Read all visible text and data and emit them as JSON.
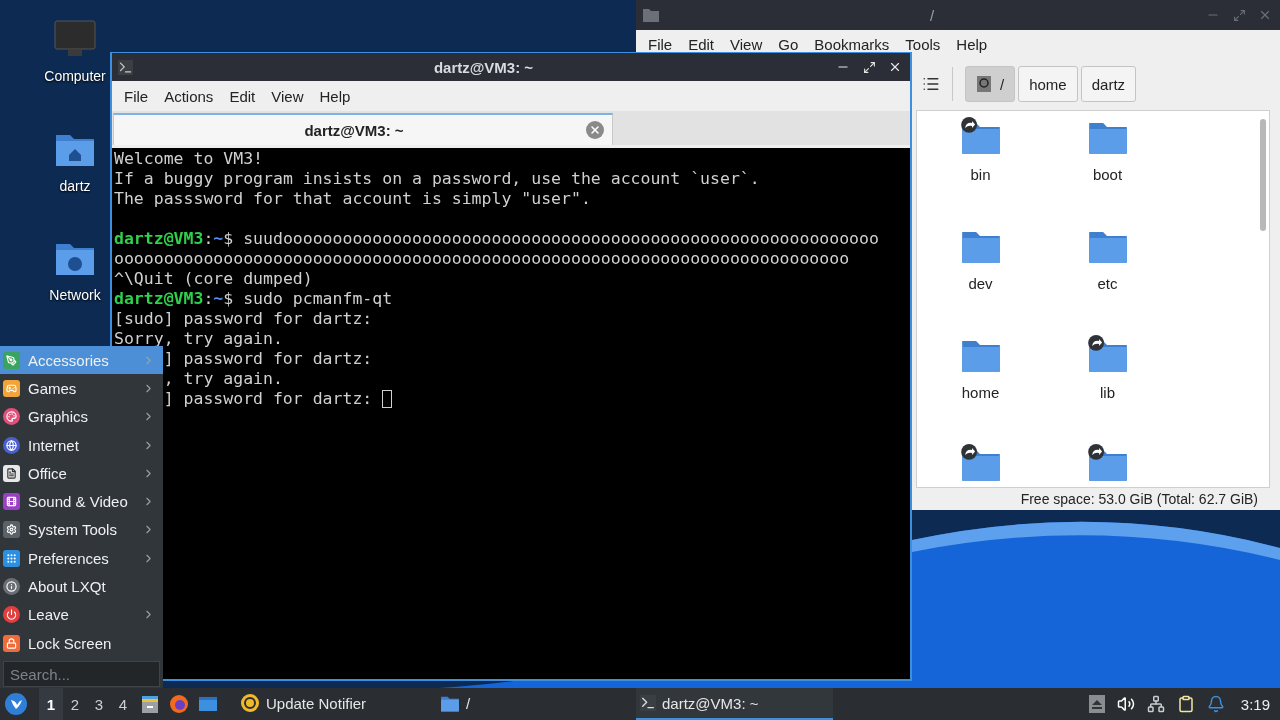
{
  "desktop_icons": [
    {
      "label": "Computer",
      "kind": "computer"
    },
    {
      "label": "dartz",
      "kind": "home"
    },
    {
      "label": "Network",
      "kind": "network"
    }
  ],
  "file_manager": {
    "title": "/",
    "menu": [
      "File",
      "Edit",
      "View",
      "Go",
      "Bookmarks",
      "Tools",
      "Help"
    ],
    "path": [
      {
        "label": "/",
        "selected": true
      },
      {
        "label": "home",
        "selected": false
      },
      {
        "label": "dartz",
        "selected": false
      }
    ],
    "items": [
      {
        "name": "bin",
        "link": true
      },
      {
        "name": "boot",
        "link": false
      },
      {
        "name": "dev",
        "link": false
      },
      {
        "name": "etc",
        "link": false
      },
      {
        "name": "home",
        "link": false
      },
      {
        "name": "lib",
        "link": true
      },
      {
        "link": true
      },
      {
        "link": true
      }
    ],
    "status": "Free space: 53.0 GiB (Total: 62.7 GiB)"
  },
  "terminal": {
    "title": "dartz@VM3: ~",
    "menu": [
      "File",
      "Actions",
      "Edit",
      "View",
      "Help"
    ],
    "tabs": [
      {
        "label": "dartz@VM3: ~",
        "selected": true
      }
    ],
    "lines": [
      {
        "kind": "text",
        "text": "Welcome to VM3!"
      },
      {
        "kind": "text",
        "text": "If a buggy program insists on a password, use the account `user`."
      },
      {
        "kind": "text",
        "text": "The passsword for that account is simply \"user\"."
      },
      {
        "kind": "blank"
      },
      {
        "kind": "prompt",
        "user": "dartz@VM3",
        "sep": ":",
        "path": "~",
        "symbol": "$",
        "command": "suudoooooooooooooooooooooooooooooooooooooooooooooooooooooooooooo"
      },
      {
        "kind": "text",
        "text": "oooooooooooooooooooooooooooooooooooooooooooooooooooooooooooooooooooooooooo"
      },
      {
        "kind": "text",
        "text": "^\\Quit (core dumped)"
      },
      {
        "kind": "prompt",
        "user": "dartz@VM3",
        "sep": ":",
        "path": "~",
        "symbol": "$",
        "command": "sudo pcmanfm-qt"
      },
      {
        "kind": "text",
        "text": "[sudo] password for dartz:"
      },
      {
        "kind": "text",
        "text": "Sorry, try again."
      },
      {
        "kind": "covered",
        "text": "] password for dartz:"
      },
      {
        "kind": "covered",
        "text": ", try again."
      },
      {
        "kind": "covered",
        "text": "] password for dartz:",
        "cursor": true
      }
    ]
  },
  "start_menu": {
    "items": [
      {
        "label": "Accessories",
        "kind": "accessories",
        "selected": true,
        "submenu": true
      },
      {
        "label": "Games",
        "kind": "games",
        "selected": false,
        "submenu": true
      },
      {
        "label": "Graphics",
        "kind": "graphics",
        "selected": false,
        "submenu": true
      },
      {
        "label": "Internet",
        "kind": "internet",
        "selected": false,
        "submenu": true
      },
      {
        "label": "Office",
        "kind": "office",
        "selected": false,
        "submenu": true
      },
      {
        "label": "Sound & Video",
        "kind": "multimedia",
        "selected": false,
        "submenu": true
      },
      {
        "label": "System Tools",
        "kind": "system",
        "selected": false,
        "submenu": true
      },
      {
        "label": "Preferences",
        "kind": "preferences",
        "selected": false,
        "submenu": true
      },
      {
        "label": "About LXQt",
        "kind": "about",
        "selected": false,
        "submenu": false
      },
      {
        "label": "Leave",
        "kind": "leave",
        "selected": false,
        "submenu": true
      },
      {
        "label": "Lock Screen",
        "kind": "lock",
        "selected": false,
        "submenu": false
      }
    ],
    "search": {
      "placeholder": "Search..."
    }
  },
  "taskbar": {
    "desktops": [
      {
        "label": "1",
        "selected": true
      },
      {
        "label": "2",
        "selected": false
      },
      {
        "label": "3",
        "selected": false
      },
      {
        "label": "4",
        "selected": false
      }
    ],
    "tasks": [
      {
        "label": "Update Notifier",
        "kind": "notifier",
        "selected": false
      },
      {
        "label": "/",
        "kind": "folder",
        "selected": false
      },
      {
        "label": "dartz@VM3: ~",
        "kind": "terminal",
        "selected": true
      }
    ],
    "clock": "3:19"
  }
}
